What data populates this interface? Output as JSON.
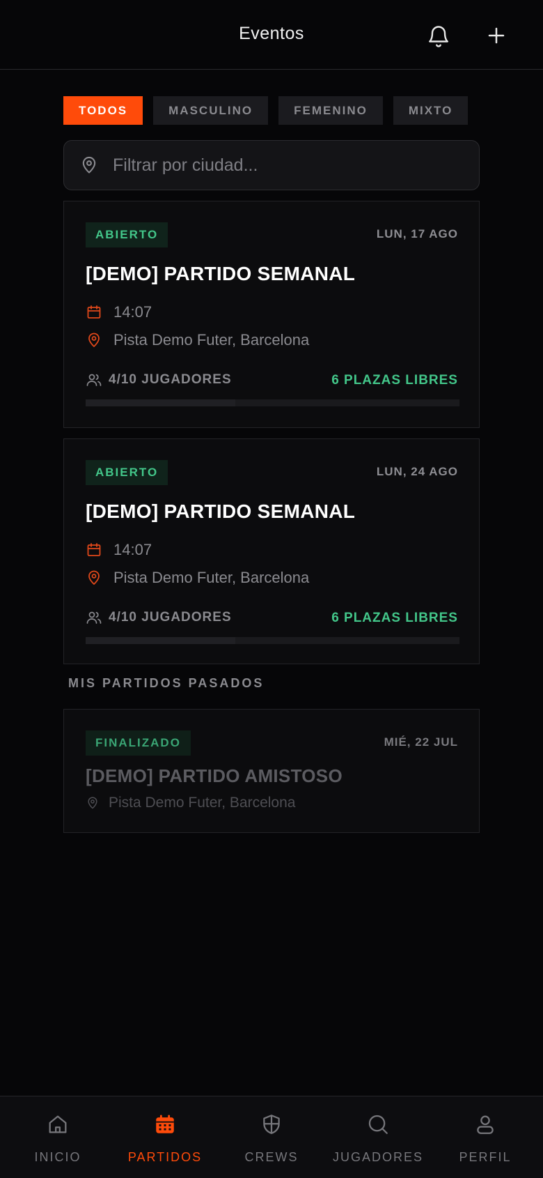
{
  "header": {
    "title": "Eventos"
  },
  "colors": {
    "accent": "#ff4b0a",
    "success": "#43c78a",
    "background": "#060608"
  },
  "filters": [
    {
      "label": "TODOS",
      "active": true
    },
    {
      "label": "MASCULINO",
      "active": false
    },
    {
      "label": "FEMENINO",
      "active": false
    },
    {
      "label": "MIXTO",
      "active": false
    }
  ],
  "search": {
    "placeholder": "Filtrar por ciudad...",
    "icon": "map-pin-icon"
  },
  "upcoming": [
    {
      "status": "ABIERTO",
      "date": "LUN, 17 AGO",
      "title": "[DEMO] PARTIDO SEMANAL",
      "time": "14:07",
      "location": "Pista Demo Futer, Barcelona",
      "players": "4/10 JUGADORES",
      "free": "6 PLAZAS LIBRES",
      "fill_fraction": 0.4
    },
    {
      "status": "ABIERTO",
      "date": "LUN, 24 AGO",
      "title": "[DEMO] PARTIDO SEMANAL",
      "time": "14:07",
      "location": "Pista Demo Futer, Barcelona",
      "players": "4/10 JUGADORES",
      "free": "6 PLAZAS LIBRES",
      "fill_fraction": 0.4
    }
  ],
  "past": {
    "section_title": "MIS PARTIDOS PASADOS",
    "items": [
      {
        "status": "FINALIZADO",
        "date": "MIÉ, 22 JUL",
        "title": "[DEMO] PARTIDO AMISTOSO",
        "location": "Pista Demo Futer, Barcelona"
      }
    ]
  },
  "tabbar": [
    {
      "label": "INICIO",
      "icon": "home-icon",
      "active": false
    },
    {
      "label": "PARTIDOS",
      "icon": "calendar-icon",
      "active": true
    },
    {
      "label": "CREWS",
      "icon": "shield-icon",
      "active": false
    },
    {
      "label": "JUGADORES",
      "icon": "search-icon",
      "active": false
    },
    {
      "label": "PERFIL",
      "icon": "user-icon",
      "active": false
    }
  ]
}
